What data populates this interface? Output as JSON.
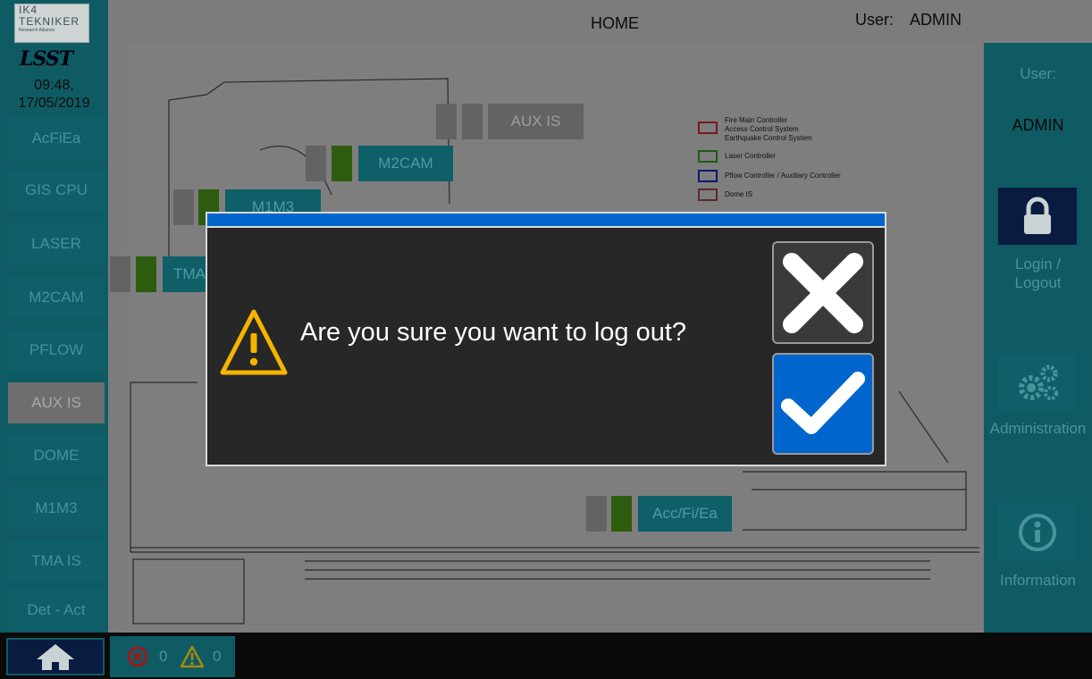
{
  "header": {
    "title": "HOME",
    "user_label": "User:",
    "user_value": "ADMIN"
  },
  "logo": {
    "company_line1": "IK4",
    "company_line2": "TEKNIKER",
    "company_line3": "Research Alliance",
    "brand": "LSST"
  },
  "clock": {
    "time": "09:48,",
    "date": "17/05/2019"
  },
  "sidebar": {
    "items": [
      {
        "label": "AcFiEa"
      },
      {
        "label": "GIS CPU"
      },
      {
        "label": "LASER"
      },
      {
        "label": "M2CAM"
      },
      {
        "label": "PFLOW"
      },
      {
        "label": "AUX IS"
      },
      {
        "label": "DOME"
      },
      {
        "label": "M1M3"
      },
      {
        "label": "TMA IS"
      },
      {
        "label": "Det - Act"
      }
    ],
    "active": "AUX IS"
  },
  "right_panel": {
    "user_label": "User:",
    "user_value": "ADMIN",
    "login_label": "Login /\nLogout",
    "admin_label": "Administration",
    "info_label": "Information"
  },
  "drawing": {
    "zones": {
      "aux_is": "AUX IS",
      "m2cam": "M2CAM",
      "m1m3": "M1M3",
      "tma": "TMA",
      "accfiea": "Acc/Fi/Ea"
    },
    "legend": [
      {
        "color": "#9b1c1c",
        "text": "Fire Main Controller\nAccess Control System\nEarthquake Control System"
      },
      {
        "color": "#2e7d1a",
        "text": "Laser Controller"
      },
      {
        "color": "#1a1a9b",
        "text": "Pflow Controller / Auxiliary Controller"
      },
      {
        "color": "#8b3a3a",
        "text": "Dome IS"
      }
    ]
  },
  "alarms": {
    "errors": "0",
    "warnings": "0"
  },
  "dialog": {
    "message": "Are you sure you want to log out?"
  },
  "colors": {
    "accent_blue": "#0066cc",
    "panel_teal": "#0f5b63",
    "warning_yellow": "#f5b400",
    "error_red": "#b01010"
  }
}
